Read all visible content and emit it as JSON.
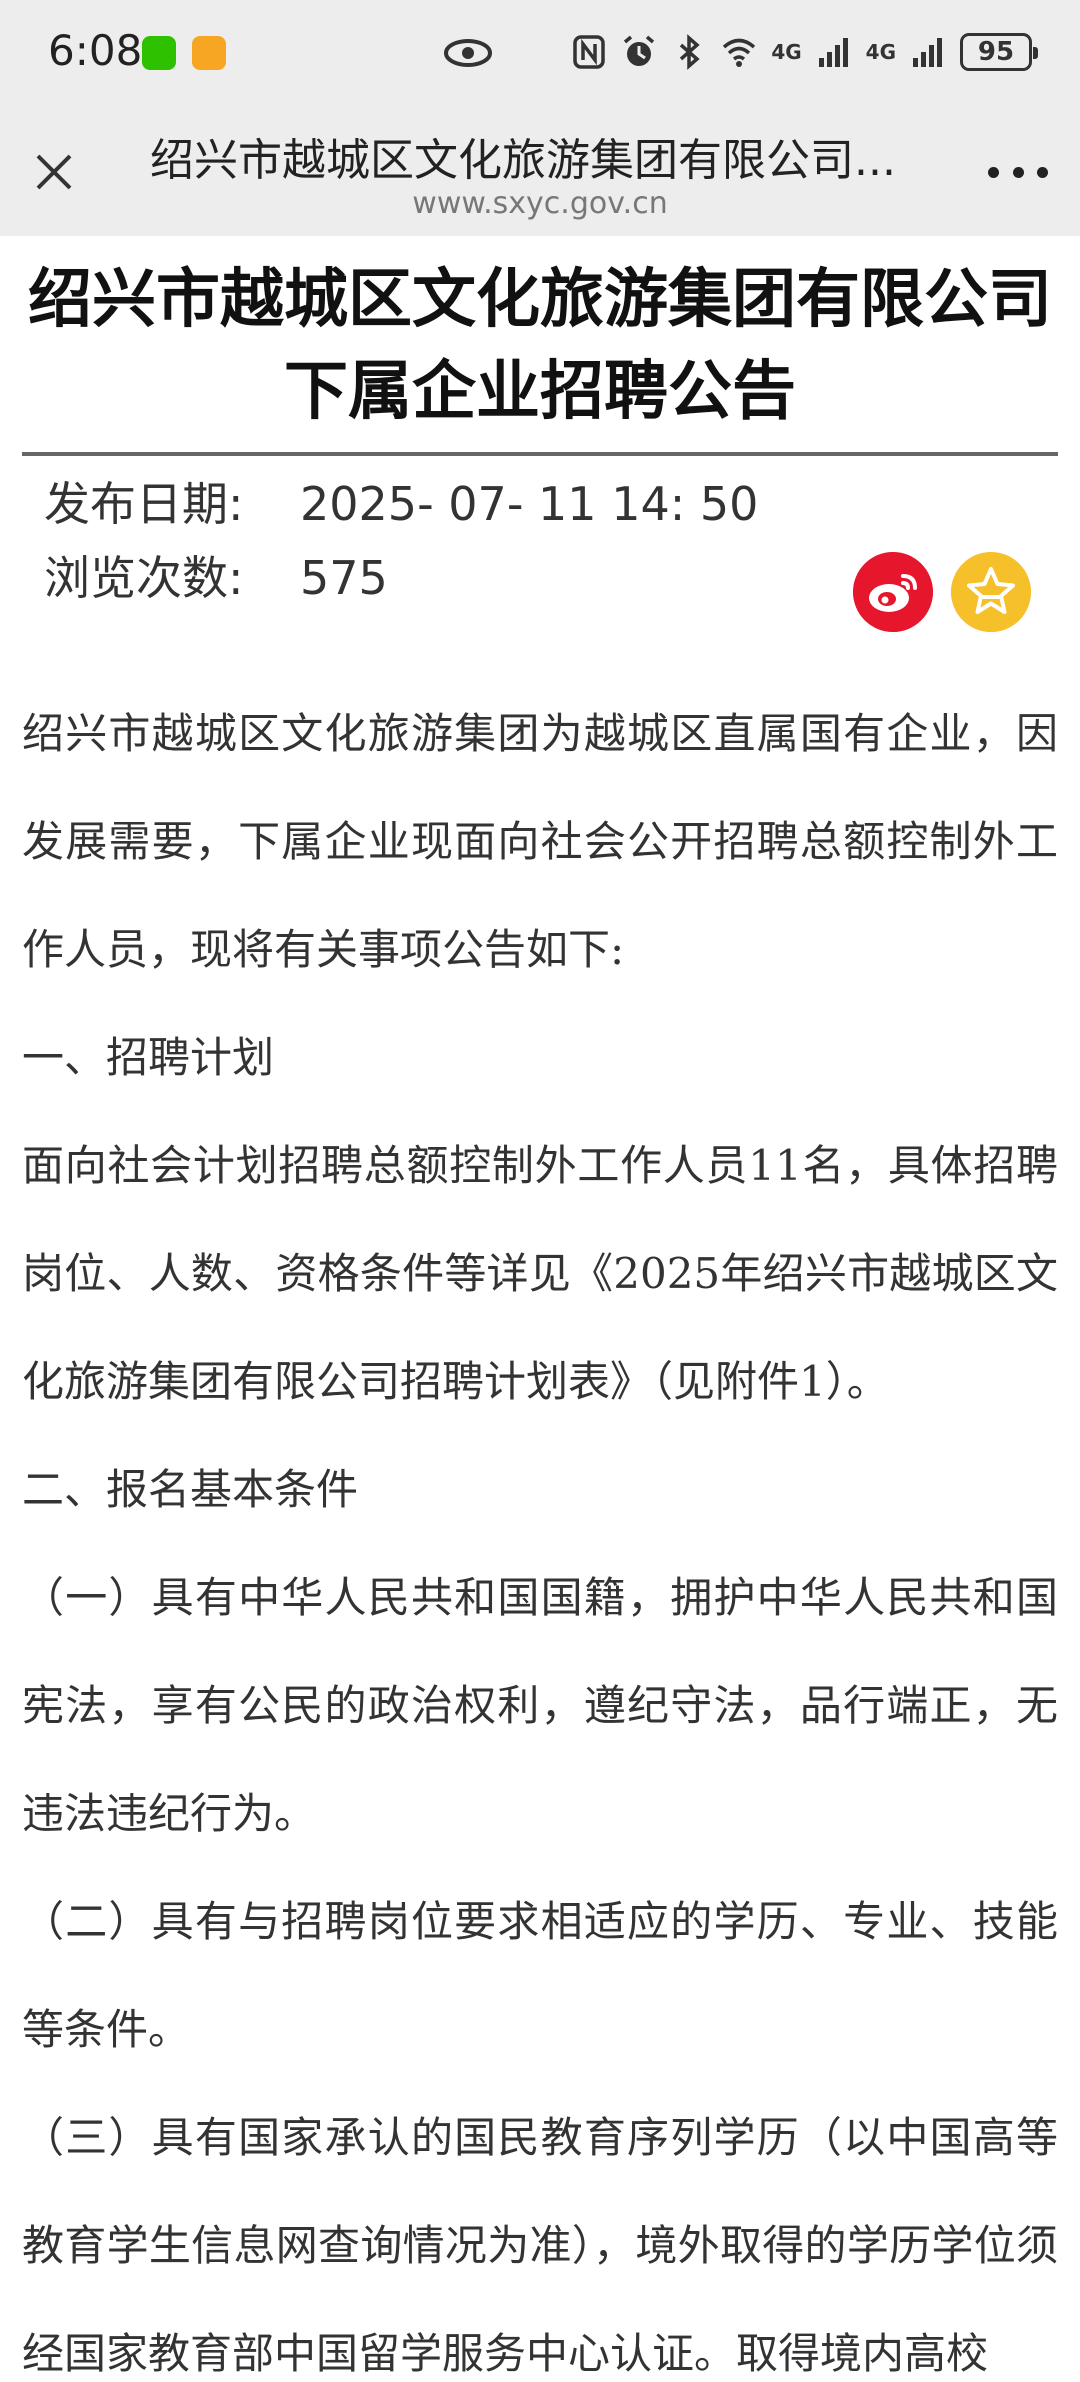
{
  "status_bar": {
    "time": "6:08",
    "network_1": "4G",
    "network_2": "4G",
    "battery": "95"
  },
  "browser": {
    "title": "绍兴市越城区文化旅游集团有限公司...",
    "url": "www.sxyc.gov.cn"
  },
  "article": {
    "title_line1": "绍兴市越城区文化旅游集团有限公司",
    "title_line2": "下属企业招聘公告",
    "publish_label": "发布日期:",
    "publish_value": "2025- 07- 11 14: 50",
    "views_label": "浏览次数:",
    "views_value": "575",
    "paragraphs": [
      "绍兴市越城区文化旅游集团为越城区直属国有企业，因发展需要，下属企业现面向社会公开招聘总额控制外工作人员，现将有关事项公告如下:",
      "一、招聘计划",
      "面向社会计划招聘总额控制外工作人员11名，具体招聘岗位、人数、资格条件等详见《2025年绍兴市越城区文化旅游集团有限公司招聘计划表》（见附件1）。",
      "二、报名基本条件",
      "（一）具有中华人民共和国国籍，拥护中华人民共和国宪法，享有公民的政治权利，遵纪守法，品行端正，无违法违纪行为。",
      "（二）具有与招聘岗位要求相适应的学历、专业、技能等条件。",
      "（三）具有国家承认的国民教育序列学历（以中国高等教育学生信息网查询情况为准），境外取得的学历学位须经国家教育部中国留学服务中心认证。取得境内高校"
    ]
  },
  "colors": {
    "weibo": "#e6162d",
    "favorite": "#f5c02a",
    "wechat": "#2dc100"
  }
}
